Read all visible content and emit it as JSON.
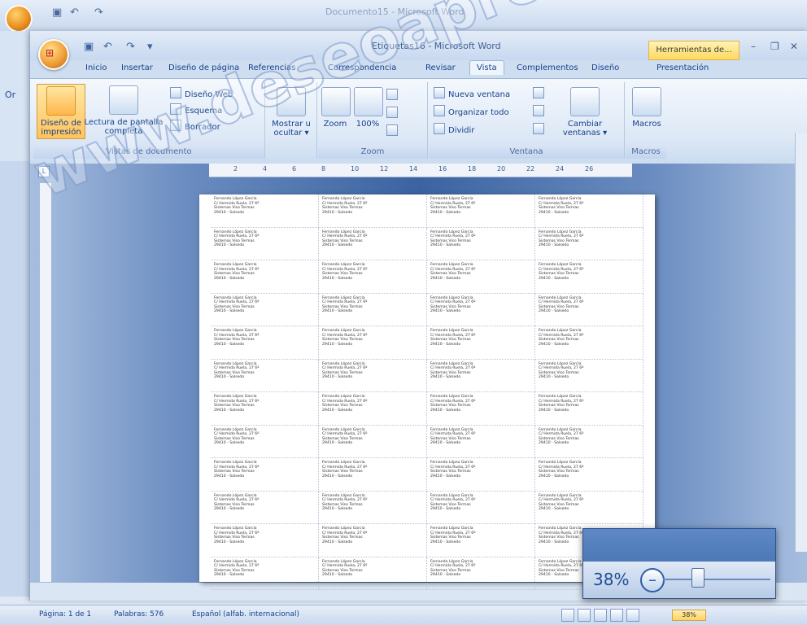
{
  "back_window": {
    "title": "Documento15 - Microsoft Word",
    "ribbon_snippet": "Or"
  },
  "window": {
    "title": "Etiquetas16 - Microsoft Word",
    "context_tab": "Herramientas de...",
    "controls": {
      "minimize": "–",
      "restore": "❐",
      "close": "✕"
    }
  },
  "tabs": [
    "Inicio",
    "Insertar",
    "Diseño de página",
    "Referencias",
    "Correspondencia",
    "Revisar",
    "Vista",
    "Complementos",
    "Diseño",
    "Presentación"
  ],
  "active_tab": "Vista",
  "ribbon": {
    "vistas": {
      "label": "Vistas de documento",
      "diseno_impresion": "Diseño de impresión",
      "lectura": "Lectura de pantalla completa",
      "diseno_web": "Diseño Web",
      "esquema": "Esquema",
      "borrador": "Borrador"
    },
    "mostrar": {
      "label": "Mostrar u ocultar ▾"
    },
    "zoom": {
      "label": "Zoom",
      "zoom_btn": "Zoom",
      "pct_btn": "100%"
    },
    "ventana": {
      "label": "Ventana",
      "nueva": "Nueva ventana",
      "organizar": "Organizar todo",
      "dividir": "Dividir",
      "cambiar": "Cambiar ventanas ▾"
    },
    "macros": {
      "label": "Macros",
      "btn": "Macros"
    }
  },
  "ruler_ticks": [
    "2",
    "4",
    "6",
    "8",
    "10",
    "12",
    "14",
    "16",
    "18",
    "20",
    "22",
    "24",
    "26"
  ],
  "label_lines": [
    "Fernando López García",
    "C/ Hermida Ruela, 27 6º",
    "Sistemas Viso Termas",
    "29410 - Salsedo"
  ],
  "label_count": 48,
  "status": {
    "page": "Página: 1 de 1",
    "words": "Palabras: 576",
    "language": "Español (alfab. internacional)",
    "zoom": "38%"
  },
  "zoom_overlay": {
    "percent": "38%",
    "minus": "–",
    "plus": "+",
    "level": 0.38
  },
  "watermark": "www.deseoaprender.com"
}
